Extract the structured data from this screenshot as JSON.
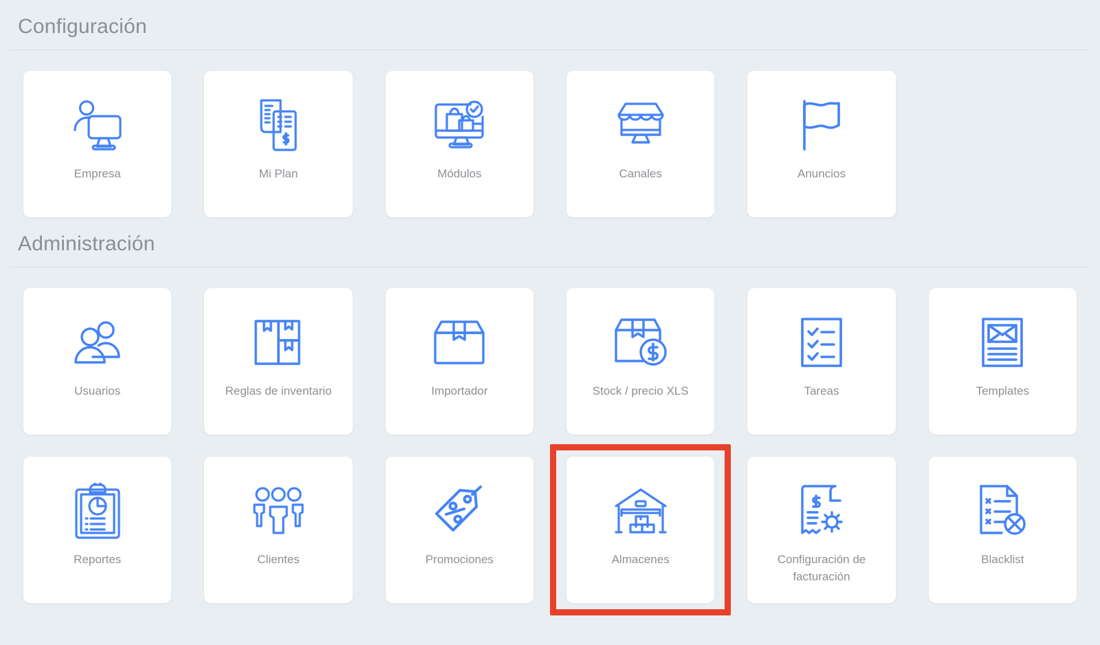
{
  "sections": [
    {
      "title": "Configuración",
      "cards": [
        {
          "label": "Empresa",
          "icon": "company-monitor-icon"
        },
        {
          "label": "Mi Plan",
          "icon": "invoice-documents-icon"
        },
        {
          "label": "Módulos",
          "icon": "monitor-shopping-bags-check-icon"
        },
        {
          "label": "Canales",
          "icon": "storefront-monitor-icon"
        },
        {
          "label": "Anuncios",
          "icon": "flag-icon"
        }
      ]
    },
    {
      "title": "Administración",
      "cards": [
        {
          "label": "Usuarios",
          "icon": "two-users-icon"
        },
        {
          "label": "Reglas de inventario",
          "icon": "stacked-boxes-icon"
        },
        {
          "label": "Importador",
          "icon": "box-icon"
        },
        {
          "label": "Stock / precio XLS",
          "icon": "box-dollar-icon"
        },
        {
          "label": "Tareas",
          "icon": "checklist-icon"
        },
        {
          "label": "Templates",
          "icon": "document-envelope-icon"
        },
        {
          "label": "Reportes",
          "icon": "clipboard-chart-icon"
        },
        {
          "label": "Clientes",
          "icon": "three-people-icon"
        },
        {
          "label": "Promociones",
          "icon": "price-tag-percent-icon"
        },
        {
          "label": "Almacenes",
          "icon": "warehouse-icon",
          "highlighted": true
        },
        {
          "label": "Configuración de facturación",
          "icon": "invoice-gear-icon"
        },
        {
          "label": "Blacklist",
          "icon": "document-x-icon"
        }
      ]
    }
  ],
  "colors": {
    "background": "#e9eef2",
    "card": "#ffffff",
    "icon_blue": "#4583f5",
    "label_gray": "#8b9095",
    "header_gray": "#8a8f94",
    "highlight_red": "#e8412a"
  }
}
